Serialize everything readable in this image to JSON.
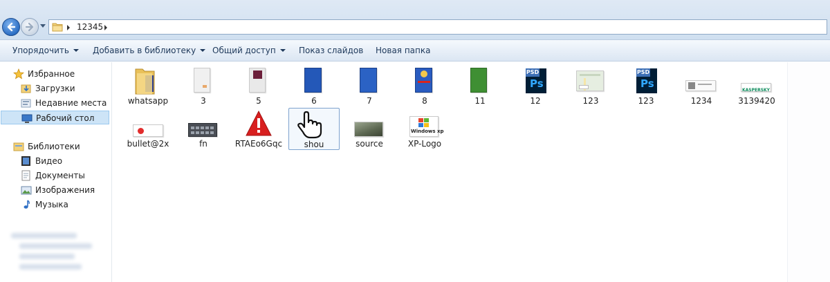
{
  "address": {
    "path": [
      "12345"
    ]
  },
  "toolbar": {
    "organize": "Упорядочить",
    "add_to_library": "Добавить в библиотеку",
    "share": "Общий доступ",
    "slideshow": "Показ слайдов",
    "new_folder": "Новая папка"
  },
  "sidebar": {
    "favorites": "Избранное",
    "downloads": "Загрузки",
    "recent": "Недавние места",
    "desktop": "Рабочий стол",
    "libraries": "Библиотеки",
    "video": "Видео",
    "documents": "Документы",
    "pictures": "Изображения",
    "music": "Музыка"
  },
  "files": [
    {
      "name": "whatsapp",
      "icon": "folder-icon"
    },
    {
      "name": "3",
      "icon": "image-thumbnail-icon"
    },
    {
      "name": "5",
      "icon": "image-thumbnail-icon"
    },
    {
      "name": "6",
      "icon": "image-thumbnail-icon"
    },
    {
      "name": "7",
      "icon": "image-thumbnail-icon"
    },
    {
      "name": "8",
      "icon": "image-thumbnail-icon"
    },
    {
      "name": "11",
      "icon": "image-thumbnail-icon"
    },
    {
      "name": "12",
      "icon": "psd-file-icon"
    },
    {
      "name": "123",
      "icon": "map-thumbnail-icon"
    },
    {
      "name": "123",
      "icon": "psd-file-icon"
    },
    {
      "name": "1234",
      "icon": "image-thumbnail-icon"
    },
    {
      "name": "3139420",
      "icon": "image-thumbnail-icon",
      "logo_text": "KASPERSKY"
    },
    {
      "name": "bullet@2x",
      "icon": "red-bullet-icon"
    },
    {
      "name": "fn",
      "icon": "keyboard-thumbnail-icon"
    },
    {
      "name": "RTAEo6Gqc",
      "icon": "warning-icon"
    },
    {
      "name": "shou",
      "icon": "hand-cursor-icon",
      "selected": true
    },
    {
      "name": "source",
      "icon": "photo-thumbnail-icon"
    },
    {
      "name": "XP-Logo",
      "icon": "windows-xp-logo-icon",
      "logo_text": "Windows xp"
    }
  ],
  "colors": {
    "selection_border": "#7da2ce",
    "sidebar_selection": "#cde4f7",
    "toolbar_text": "#1e395b"
  }
}
